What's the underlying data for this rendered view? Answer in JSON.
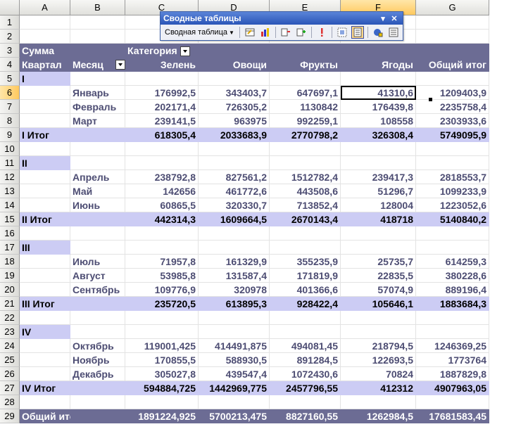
{
  "columns": [
    "A",
    "B",
    "C",
    "D",
    "E",
    "F",
    "G"
  ],
  "rows": [
    {
      "n": "1",
      "type": "blank"
    },
    {
      "n": "2",
      "type": "blank"
    },
    {
      "n": "3",
      "type": "hdr",
      "a": "Сумма",
      "b": "",
      "c": "Категория",
      "d": "",
      "e": "",
      "f": "",
      "g": ""
    },
    {
      "n": "4",
      "type": "hdr",
      "a": "Квартал",
      "b": "Месяц",
      "c": "Зелень",
      "d": "Овощи",
      "e": "Фрукты",
      "f": "Ягоды",
      "g": "Общий итог"
    },
    {
      "n": "5",
      "type": "qtr",
      "a": "I"
    },
    {
      "n": "6",
      "type": "detail",
      "b": "Январь",
      "c": "176992,5",
      "d": "343403,7",
      "e": "647697,1",
      "f": "41310,6",
      "g": "1209403,9"
    },
    {
      "n": "7",
      "type": "detail",
      "b": "Февраль",
      "c": "202171,4",
      "d": "726305,2",
      "e": "1130842",
      "f": "176439,8",
      "g": "2235758,4"
    },
    {
      "n": "8",
      "type": "detail",
      "b": "Март",
      "c": "239141,5",
      "d": "963975",
      "e": "992259,1",
      "f": "108558",
      "g": "2303933,6"
    },
    {
      "n": "9",
      "type": "sub",
      "a": "I Итог",
      "c": "618305,4",
      "d": "2033683,9",
      "e": "2770798,2",
      "f": "326308,4",
      "g": "5749095,9"
    },
    {
      "n": "10",
      "type": "blank"
    },
    {
      "n": "11",
      "type": "qtr",
      "a": "II"
    },
    {
      "n": "12",
      "type": "detail",
      "b": "Апрель",
      "c": "238792,8",
      "d": "827561,2",
      "e": "1512782,4",
      "f": "239417,3",
      "g": "2818553,7"
    },
    {
      "n": "13",
      "type": "detail",
      "b": "Май",
      "c": "142656",
      "d": "461772,6",
      "e": "443508,6",
      "f": "51296,7",
      "g": "1099233,9"
    },
    {
      "n": "14",
      "type": "detail",
      "b": "Июнь",
      "c": "60865,5",
      "d": "320330,7",
      "e": "713852,4",
      "f": "128004",
      "g": "1223052,6"
    },
    {
      "n": "15",
      "type": "sub",
      "a": "II Итог",
      "c": "442314,3",
      "d": "1609664,5",
      "e": "2670143,4",
      "f": "418718",
      "g": "5140840,2"
    },
    {
      "n": "16",
      "type": "blank"
    },
    {
      "n": "17",
      "type": "qtr",
      "a": "III"
    },
    {
      "n": "18",
      "type": "detail",
      "b": "Июль",
      "c": "71957,8",
      "d": "161329,9",
      "e": "355235,9",
      "f": "25735,7",
      "g": "614259,3"
    },
    {
      "n": "19",
      "type": "detail",
      "b": "Август",
      "c": "53985,8",
      "d": "131587,4",
      "e": "171819,9",
      "f": "22835,5",
      "g": "380228,6"
    },
    {
      "n": "20",
      "type": "detail",
      "b": "Сентябрь",
      "c": "109776,9",
      "d": "320978",
      "e": "401366,6",
      "f": "57074,9",
      "g": "889196,4"
    },
    {
      "n": "21",
      "type": "sub",
      "a": "III Итог",
      "c": "235720,5",
      "d": "613895,3",
      "e": "928422,4",
      "f": "105646,1",
      "g": "1883684,3"
    },
    {
      "n": "22",
      "type": "blank"
    },
    {
      "n": "23",
      "type": "qtr",
      "a": "IV"
    },
    {
      "n": "24",
      "type": "detail",
      "b": "Октябрь",
      "c": "119001,425",
      "d": "414491,875",
      "e": "494081,45",
      "f": "218794,5",
      "g": "1246369,25"
    },
    {
      "n": "25",
      "type": "detail",
      "b": "Ноябрь",
      "c": "170855,5",
      "d": "588930,5",
      "e": "891284,5",
      "f": "122693,5",
      "g": "1773764"
    },
    {
      "n": "26",
      "type": "detail",
      "b": "Декабрь",
      "c": "305027,8",
      "d": "439547,4",
      "e": "1072430,6",
      "f": "70824",
      "g": "1887829,8"
    },
    {
      "n": "27",
      "type": "sub",
      "a": "IV Итог",
      "c": "594884,725",
      "d": "1442969,775",
      "e": "2457796,55",
      "f": "412312",
      "g": "4907963,05"
    },
    {
      "n": "28",
      "type": "blank"
    },
    {
      "n": "29",
      "type": "grand",
      "a": "Общий итог",
      "c": "1891224,925",
      "d": "5700213,475",
      "e": "8827160,55",
      "f": "1262984,5",
      "g": "17681583,45"
    }
  ],
  "pivot_toolbar": {
    "title": "Сводные таблицы",
    "menu_label": "Сводная таблица",
    "icons": [
      "format-report-icon",
      "chart-wizard-icon",
      "hide-detail-icon",
      "show-detail-icon",
      "refresh-data-icon",
      "field-settings-icon",
      "field-list-icon",
      "field-settings-alt-icon",
      "list-icon"
    ]
  },
  "colors": {
    "header_bg": "#6c6c94",
    "subtotal_bg": "#ccccf4",
    "detail_text": "#4d4d73"
  }
}
